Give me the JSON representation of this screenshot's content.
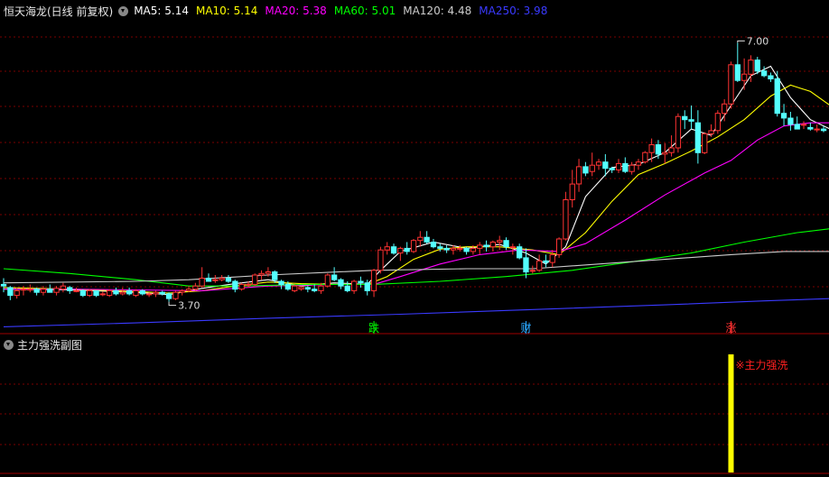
{
  "header": {
    "title": "恒天海龙(日线 前复权)",
    "ma": [
      {
        "label": "MA5: 5.14",
        "color": "#ffffff"
      },
      {
        "label": "MA10: 5.14",
        "color": "#ffff00"
      },
      {
        "label": "MA20: 5.38",
        "color": "#ff00ff"
      },
      {
        "label": "MA60: 5.01",
        "color": "#00ff00"
      },
      {
        "label": "MA120: 4.48",
        "color": "#cccccc"
      },
      {
        "label": "MA250: 3.98",
        "color": "#3a3aff"
      }
    ]
  },
  "sub_panel": {
    "title": "主力强洗副图",
    "signal_label": "※主力强洗"
  },
  "markers": [
    {
      "label": "跌",
      "color": "#00ff00",
      "candle_index": 56
    },
    {
      "label": "财",
      "color": "#2aa8ff",
      "candle_index": 79
    },
    {
      "label": "涨",
      "color": "#ff3030",
      "candle_index": 110
    }
  ],
  "colors": {
    "up": "#ff3333",
    "down": "#54ffff",
    "grid": "#7a0000",
    "signal_bar": "#ffff00"
  },
  "chart_data": {
    "type": "candlestick",
    "annotations": [
      {
        "label": "7.00",
        "type": "high"
      },
      {
        "label": "3.70",
        "type": "low"
      }
    ],
    "candles": [
      [
        3.92,
        4.0,
        3.82,
        3.9
      ],
      [
        3.88,
        3.9,
        3.72,
        3.78
      ],
      [
        3.78,
        3.88,
        3.74,
        3.84
      ],
      [
        3.86,
        3.9,
        3.78,
        3.86
      ],
      [
        3.86,
        3.92,
        3.82,
        3.86
      ],
      [
        3.86,
        3.88,
        3.78,
        3.82
      ],
      [
        3.82,
        3.9,
        3.78,
        3.86
      ],
      [
        3.86,
        3.92,
        3.82,
        3.82
      ],
      [
        3.82,
        3.9,
        3.78,
        3.87
      ],
      [
        3.86,
        3.94,
        3.82,
        3.9
      ],
      [
        3.88,
        3.9,
        3.8,
        3.84
      ],
      [
        3.84,
        3.88,
        3.82,
        3.84
      ],
      [
        3.84,
        3.86,
        3.76,
        3.78
      ],
      [
        3.78,
        3.86,
        3.76,
        3.84
      ],
      [
        3.84,
        3.84,
        3.76,
        3.78
      ],
      [
        3.8,
        3.83,
        3.77,
        3.8
      ],
      [
        3.78,
        3.86,
        3.76,
        3.84
      ],
      [
        3.84,
        3.88,
        3.78,
        3.8
      ],
      [
        3.8,
        3.88,
        3.78,
        3.82
      ],
      [
        3.84,
        3.88,
        3.78,
        3.8
      ],
      [
        3.78,
        3.86,
        3.76,
        3.84
      ],
      [
        3.84,
        3.86,
        3.78,
        3.8
      ],
      [
        3.8,
        3.82,
        3.76,
        3.8
      ],
      [
        3.8,
        3.84,
        3.76,
        3.82
      ],
      [
        3.82,
        3.84,
        3.78,
        3.8
      ],
      [
        3.8,
        3.82,
        3.7,
        3.74
      ],
      [
        3.74,
        3.84,
        3.72,
        3.82
      ],
      [
        3.82,
        3.86,
        3.78,
        3.84
      ],
      [
        3.84,
        3.9,
        3.82,
        3.86
      ],
      [
        3.86,
        3.94,
        3.84,
        3.9
      ],
      [
        3.9,
        4.14,
        3.88,
        4.0
      ],
      [
        4.0,
        4.06,
        3.96,
        3.96
      ],
      [
        3.98,
        4.04,
        3.94,
        3.98
      ],
      [
        3.98,
        4.04,
        3.96,
        4.0
      ],
      [
        4.0,
        4.04,
        3.94,
        3.96
      ],
      [
        3.96,
        3.98,
        3.82,
        3.86
      ],
      [
        3.86,
        3.94,
        3.84,
        3.92
      ],
      [
        3.92,
        3.96,
        3.88,
        3.92
      ],
      [
        3.92,
        4.06,
        3.9,
        4.04
      ],
      [
        4.04,
        4.1,
        3.98,
        4.06
      ],
      [
        4.06,
        4.14,
        4.02,
        4.08
      ],
      [
        4.08,
        4.1,
        3.94,
        3.98
      ],
      [
        3.96,
        3.98,
        3.86,
        3.92
      ],
      [
        3.92,
        3.96,
        3.84,
        3.86
      ],
      [
        3.84,
        3.92,
        3.82,
        3.9
      ],
      [
        3.86,
        3.9,
        3.84,
        3.88
      ],
      [
        3.88,
        3.9,
        3.82,
        3.86
      ],
      [
        3.86,
        3.92,
        3.82,
        3.84
      ],
      [
        3.84,
        3.94,
        3.8,
        3.9
      ],
      [
        3.9,
        4.06,
        3.88,
        4.04
      ],
      [
        4.04,
        4.14,
        3.96,
        3.98
      ],
      [
        3.98,
        4.0,
        3.86,
        3.9
      ],
      [
        3.9,
        3.96,
        3.82,
        3.84
      ],
      [
        3.84,
        3.98,
        3.8,
        3.96
      ],
      [
        3.96,
        4.02,
        3.88,
        3.94
      ],
      [
        3.94,
        3.98,
        3.78,
        3.84
      ],
      [
        3.84,
        4.12,
        3.76,
        4.1
      ],
      [
        4.1,
        4.4,
        4.06,
        4.36
      ],
      [
        4.36,
        4.46,
        4.3,
        4.4
      ],
      [
        4.4,
        4.44,
        4.3,
        4.32
      ],
      [
        4.32,
        4.4,
        4.22,
        4.38
      ],
      [
        4.38,
        4.46,
        4.3,
        4.34
      ],
      [
        4.34,
        4.5,
        4.32,
        4.48
      ],
      [
        4.48,
        4.6,
        4.4,
        4.52
      ],
      [
        4.52,
        4.6,
        4.44,
        4.46
      ],
      [
        4.46,
        4.5,
        4.38,
        4.4
      ],
      [
        4.4,
        4.44,
        4.34,
        4.38
      ],
      [
        4.38,
        4.42,
        4.32,
        4.36
      ],
      [
        4.36,
        4.42,
        4.3,
        4.38
      ],
      [
        4.38,
        4.42,
        4.34,
        4.38
      ],
      [
        4.38,
        4.4,
        4.3,
        4.34
      ],
      [
        4.34,
        4.42,
        4.3,
        4.38
      ],
      [
        4.38,
        4.46,
        4.3,
        4.42
      ],
      [
        4.42,
        4.48,
        4.34,
        4.4
      ],
      [
        4.4,
        4.48,
        4.34,
        4.46
      ],
      [
        4.46,
        4.54,
        4.36,
        4.48
      ],
      [
        4.48,
        4.52,
        4.36,
        4.4
      ],
      [
        4.4,
        4.44,
        4.3,
        4.4
      ],
      [
        4.4,
        4.44,
        4.24,
        4.26
      ],
      [
        4.26,
        4.38,
        4.0,
        4.08
      ],
      [
        4.1,
        4.16,
        4.06,
        4.1
      ],
      [
        4.1,
        4.3,
        4.08,
        4.22
      ],
      [
        4.22,
        4.3,
        4.14,
        4.2
      ],
      [
        4.2,
        4.36,
        4.14,
        4.3
      ],
      [
        4.3,
        4.52,
        4.26,
        4.5
      ],
      [
        4.5,
        5.1,
        4.48,
        5.0
      ],
      [
        5.0,
        5.38,
        4.9,
        5.2
      ],
      [
        5.2,
        5.52,
        5.1,
        5.42
      ],
      [
        5.42,
        5.48,
        5.3,
        5.34
      ],
      [
        5.36,
        5.6,
        5.3,
        5.44
      ],
      [
        5.44,
        5.52,
        5.38,
        5.48
      ],
      [
        5.48,
        5.58,
        5.3,
        5.4
      ],
      [
        5.4,
        5.42,
        5.34,
        5.38
      ],
      [
        5.38,
        5.52,
        5.34,
        5.46
      ],
      [
        5.46,
        5.54,
        5.34,
        5.36
      ],
      [
        5.36,
        5.48,
        5.32,
        5.44
      ],
      [
        5.44,
        5.52,
        5.38,
        5.48
      ],
      [
        5.48,
        5.62,
        5.46,
        5.6
      ],
      [
        5.6,
        5.78,
        5.48,
        5.7
      ],
      [
        5.7,
        5.76,
        5.52,
        5.58
      ],
      [
        5.58,
        5.72,
        5.46,
        5.6
      ],
      [
        5.6,
        5.82,
        5.55,
        5.66
      ],
      [
        5.66,
        6.1,
        5.6,
        6.06
      ],
      [
        6.06,
        6.14,
        5.9,
        6.02
      ],
      [
        6.02,
        6.2,
        5.9,
        6.0
      ],
      [
        5.98,
        6.14,
        5.46,
        5.6
      ],
      [
        5.6,
        5.86,
        5.58,
        5.84
      ],
      [
        5.84,
        5.96,
        5.8,
        5.88
      ],
      [
        5.88,
        6.14,
        5.84,
        6.1
      ],
      [
        6.1,
        6.28,
        6.0,
        6.22
      ],
      [
        6.22,
        6.76,
        6.16,
        6.72
      ],
      [
        6.72,
        7.0,
        6.5,
        6.52
      ],
      [
        6.52,
        6.8,
        6.4,
        6.6
      ],
      [
        6.6,
        6.84,
        6.5,
        6.78
      ],
      [
        6.78,
        6.82,
        6.6,
        6.64
      ],
      [
        6.64,
        6.7,
        6.56,
        6.58
      ],
      [
        6.58,
        6.62,
        6.5,
        6.54
      ],
      [
        6.54,
        6.64,
        6.06,
        6.1
      ],
      [
        6.1,
        6.22,
        5.94,
        6.04
      ],
      [
        6.04,
        6.12,
        5.88,
        5.96
      ],
      [
        5.96,
        6.06,
        5.9,
        5.9
      ],
      [
        5.96,
        6.0,
        5.9,
        5.96
      ],
      [
        5.92,
        5.98,
        5.88,
        5.9
      ],
      [
        5.9,
        5.96,
        5.86,
        5.9
      ],
      [
        5.9,
        5.94,
        5.86,
        5.88
      ]
    ],
    "ma_series": [
      {
        "label": "MA5",
        "color": "#ffffff",
        "points": [
          [
            0,
            3.86
          ],
          [
            10,
            3.85
          ],
          [
            20,
            3.82
          ],
          [
            25,
            3.79
          ],
          [
            30,
            3.87
          ],
          [
            35,
            3.93
          ],
          [
            40,
            3.98
          ],
          [
            45,
            3.9
          ],
          [
            50,
            3.94
          ],
          [
            55,
            3.92
          ],
          [
            57,
            4.1
          ],
          [
            60,
            4.34
          ],
          [
            65,
            4.46
          ],
          [
            70,
            4.38
          ],
          [
            75,
            4.43
          ],
          [
            79,
            4.32
          ],
          [
            82,
            4.18
          ],
          [
            85,
            4.4
          ],
          [
            88,
            5.04
          ],
          [
            92,
            5.41
          ],
          [
            96,
            5.45
          ],
          [
            100,
            5.6
          ],
          [
            104,
            5.9
          ],
          [
            107,
            5.82
          ],
          [
            110,
            6.2
          ],
          [
            113,
            6.58
          ],
          [
            116,
            6.7
          ],
          [
            119,
            6.3
          ],
          [
            122,
            6.02
          ],
          [
            125,
            5.9
          ]
        ]
      },
      {
        "label": "MA10",
        "color": "#ffff00",
        "points": [
          [
            0,
            3.88
          ],
          [
            10,
            3.86
          ],
          [
            20,
            3.83
          ],
          [
            25,
            3.81
          ],
          [
            30,
            3.84
          ],
          [
            35,
            3.9
          ],
          [
            40,
            3.95
          ],
          [
            45,
            3.93
          ],
          [
            50,
            3.92
          ],
          [
            55,
            3.92
          ],
          [
            58,
            4.02
          ],
          [
            62,
            4.24
          ],
          [
            66,
            4.37
          ],
          [
            70,
            4.4
          ],
          [
            75,
            4.4
          ],
          [
            80,
            4.36
          ],
          [
            84,
            4.3
          ],
          [
            88,
            4.58
          ],
          [
            92,
            4.98
          ],
          [
            96,
            5.32
          ],
          [
            100,
            5.46
          ],
          [
            104,
            5.62
          ],
          [
            108,
            5.8
          ],
          [
            112,
            6.02
          ],
          [
            116,
            6.32
          ],
          [
            119,
            6.46
          ],
          [
            122,
            6.38
          ],
          [
            125,
            6.2
          ]
        ]
      },
      {
        "label": "MA20",
        "color": "#ff00ff",
        "points": [
          [
            0,
            3.86
          ],
          [
            10,
            3.86
          ],
          [
            20,
            3.85
          ],
          [
            30,
            3.84
          ],
          [
            40,
            3.9
          ],
          [
            50,
            3.92
          ],
          [
            56,
            3.92
          ],
          [
            60,
            4.02
          ],
          [
            66,
            4.18
          ],
          [
            72,
            4.3
          ],
          [
            78,
            4.36
          ],
          [
            84,
            4.34
          ],
          [
            88,
            4.44
          ],
          [
            94,
            4.74
          ],
          [
            100,
            5.06
          ],
          [
            106,
            5.34
          ],
          [
            110,
            5.5
          ],
          [
            114,
            5.76
          ],
          [
            118,
            5.94
          ],
          [
            122,
            5.98
          ],
          [
            125,
            5.98
          ]
        ]
      },
      {
        "label": "MA60",
        "color": "#00ff00",
        "points": [
          [
            0,
            4.12
          ],
          [
            10,
            4.06
          ],
          [
            20,
            3.98
          ],
          [
            28,
            3.9
          ],
          [
            36,
            3.9
          ],
          [
            46,
            3.92
          ],
          [
            56,
            3.92
          ],
          [
            66,
            3.96
          ],
          [
            76,
            4.02
          ],
          [
            86,
            4.1
          ],
          [
            96,
            4.22
          ],
          [
            104,
            4.32
          ],
          [
            112,
            4.46
          ],
          [
            120,
            4.58
          ],
          [
            125,
            4.63
          ]
        ]
      },
      {
        "label": "MA120",
        "color": "#cccccc",
        "points": [
          [
            0,
            3.94
          ],
          [
            20,
            3.96
          ],
          [
            28,
            3.98
          ],
          [
            40,
            4.04
          ],
          [
            56,
            4.1
          ],
          [
            70,
            4.12
          ],
          [
            80,
            4.12
          ],
          [
            90,
            4.18
          ],
          [
            100,
            4.24
          ],
          [
            110,
            4.3
          ],
          [
            118,
            4.34
          ],
          [
            125,
            4.34
          ]
        ]
      },
      {
        "label": "MA250",
        "color": "#3a3aff",
        "points": [
          [
            0,
            3.38
          ],
          [
            20,
            3.43
          ],
          [
            40,
            3.49
          ],
          [
            60,
            3.54
          ],
          [
            80,
            3.6
          ],
          [
            100,
            3.66
          ],
          [
            115,
            3.71
          ],
          [
            125,
            3.74
          ]
        ]
      }
    ],
    "sub_signal": {
      "candle_index": 110,
      "value": 1
    }
  }
}
